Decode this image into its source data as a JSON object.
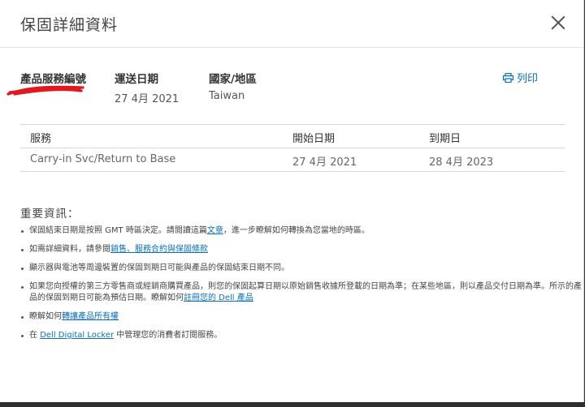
{
  "modal": {
    "title": "保固詳細資料"
  },
  "product": {
    "label": "產品服務編號"
  },
  "ship_date": {
    "label": "運送日期",
    "value": "27 4月 2021"
  },
  "country": {
    "label": "國家/地區",
    "value": "Taiwan"
  },
  "print": {
    "label": "列印",
    "icon": "printer-icon"
  },
  "table": {
    "headers": [
      "服務",
      "開始日期",
      "到期日"
    ],
    "rows": [
      [
        "Carry-in Svc/Return to Base",
        "27 4月 2021",
        "28 4月 2023"
      ]
    ]
  },
  "important": {
    "title": "重要資訊：",
    "notes": [
      {
        "text_before": "保固結束日期是按照 GMT 時區決定。請閱讀這篇",
        "link": "文章",
        "text_after": "，進一步瞭解如何轉換為您當地的時區。"
      },
      {
        "text_before": "如需詳細資料，請參閱",
        "link": "銷售、服務合約與保固條款",
        "text_after": ""
      },
      {
        "text_before": "顯示器與電池等周邊裝置的保固到期日可能與產品的保固結束日期不同。",
        "link": "",
        "text_after": ""
      },
      {
        "text_before": "如果您向授權的第三方零售商或經銷商購買產品，則您的保固起算日期以原始銷售收據所登載的日期為準；在某些地區，則以產品交付日期為準。所示的產品的保固到期日可能為預估日期。瞭解如何",
        "link": "註冊您的 Dell 產品",
        "text_after": ""
      },
      {
        "text_before": "瞭解如何",
        "link": "轉讓產品所有權",
        "text_after": ""
      },
      {
        "text_before": "在 ",
        "link": "Dell Digital Locker",
        "text_after": " 中管理您的消費者訂閱服務。"
      }
    ]
  },
  "colors": {
    "link": "#0b6fb7",
    "redaction": "#e0191f"
  }
}
